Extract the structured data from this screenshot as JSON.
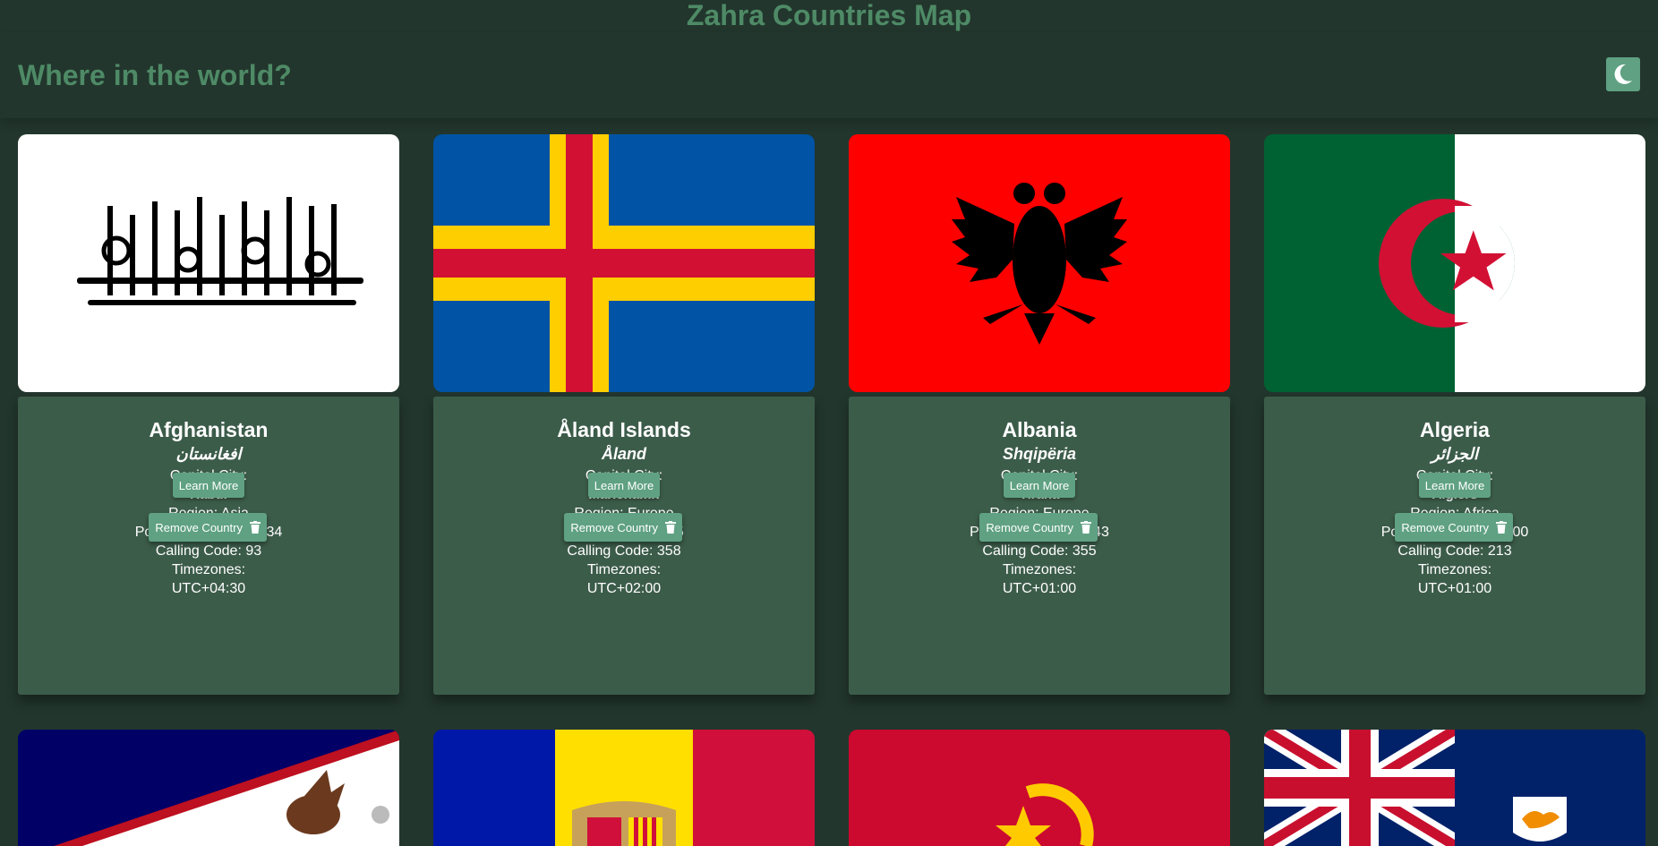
{
  "app": {
    "title": "Zahra Countries Map"
  },
  "header": {
    "title": "Where in the world?",
    "theme_icon": "moon-icon"
  },
  "labels": {
    "capital": "Capital City:",
    "timezones": "Timezones:",
    "learn_more": "Learn More",
    "remove": "Remove Country"
  },
  "countries": [
    {
      "name": "Afghanistan",
      "native": "افغانستان",
      "capital": "Kabul",
      "region": "Region: Asia",
      "population": "Population: 40,218,234",
      "calling": "Calling Code: 93",
      "timezone": "UTC+04:30"
    },
    {
      "name": "Åland Islands",
      "native": "Åland",
      "capital": "Mariehamn",
      "region": "Region: Europe",
      "population": "Population: 28,875",
      "calling": "Calling Code: 358",
      "timezone": "UTC+02:00"
    },
    {
      "name": "Albania",
      "native": "Shqipëria",
      "capital": "Tirana",
      "region": "Region: Europe",
      "population": "Population: 2,837,743",
      "calling": "Calling Code: 355",
      "timezone": "UTC+01:00"
    },
    {
      "name": "Algeria",
      "native": "الجزائر",
      "capital": "Algiers",
      "region": "Region: Africa",
      "population": "Population: 44,700,000",
      "calling": "Calling Code: 213",
      "timezone": "UTC+01:00"
    }
  ],
  "partial_flags": [
    "american-samoa-flag",
    "andorra-flag",
    "angola-flag",
    "anguilla-flag"
  ],
  "colors": {
    "background": "#22362d",
    "card": "#3c5c4a",
    "accent": "#5fa182",
    "heading": "#4e8a66"
  }
}
